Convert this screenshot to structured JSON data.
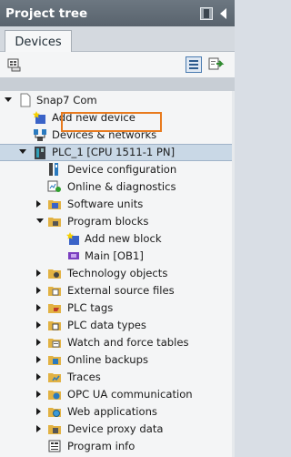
{
  "window": {
    "title": "Project tree"
  },
  "tabs": [
    {
      "label": "Devices"
    }
  ],
  "tree": {
    "items": [
      {
        "label": "Snap7 Com",
        "icon": "project-icon",
        "expanded": true
      },
      {
        "label": "Add new device",
        "icon": "add-device-icon"
      },
      {
        "label": "Devices & networks",
        "icon": "network-icon"
      },
      {
        "label": "PLC_1 [CPU 1511-1 PN]",
        "icon": "plc-icon",
        "expanded": true,
        "selected": true
      },
      {
        "label": "Device configuration",
        "icon": "device-config-icon"
      },
      {
        "label": "Online & diagnostics",
        "icon": "online-diagnostics-icon"
      },
      {
        "label": "Software units",
        "icon": "software-units-icon",
        "expanded": false
      },
      {
        "label": "Program blocks",
        "icon": "folder-icon",
        "expanded": true
      },
      {
        "label": "Add new block",
        "icon": "add-block-icon",
        "highlighted": true
      },
      {
        "label": "Main [OB1]",
        "icon": "ob-icon"
      },
      {
        "label": "Technology objects",
        "icon": "folder-icon",
        "expanded": false
      },
      {
        "label": "External source files",
        "icon": "folder-icon",
        "expanded": false
      },
      {
        "label": "PLC tags",
        "icon": "folder-icon",
        "expanded": false
      },
      {
        "label": "PLC data types",
        "icon": "folder-icon",
        "expanded": false
      },
      {
        "label": "Watch and force tables",
        "icon": "folder-icon",
        "expanded": false
      },
      {
        "label": "Online backups",
        "icon": "folder-icon",
        "expanded": false
      },
      {
        "label": "Traces",
        "icon": "folder-icon",
        "expanded": false
      },
      {
        "label": "OPC UA communication",
        "icon": "opc-ua-icon",
        "expanded": false
      },
      {
        "label": "Web applications",
        "icon": "web-icon",
        "expanded": false
      },
      {
        "label": "Device proxy data",
        "icon": "folder-icon",
        "expanded": false
      },
      {
        "label": "Program info",
        "icon": "program-info-icon"
      }
    ]
  },
  "colors": {
    "titlebar": "#616b75",
    "highlight_box": "#e87a1e",
    "selection": "#c9d8e6",
    "folder": "#e2b243"
  }
}
